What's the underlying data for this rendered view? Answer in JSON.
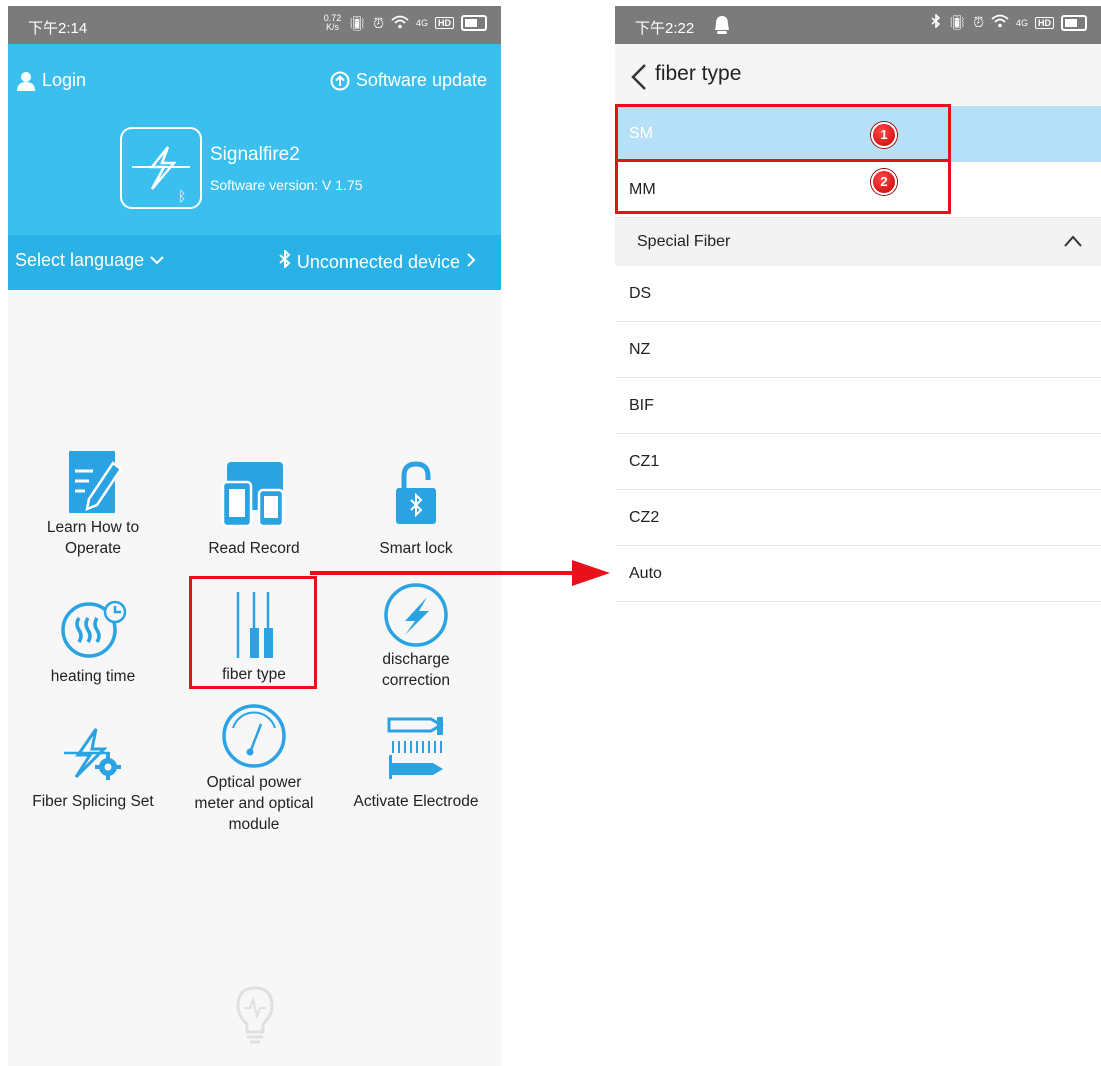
{
  "left_phone": {
    "status": {
      "time": "下午2:14",
      "speed_top": "0.72",
      "speed_bottom": "K/s",
      "signal": "4G",
      "hd": "HD"
    },
    "header": {
      "login_label": "Login",
      "software_update_label": "Software update",
      "app_name": "Signalfire2",
      "app_version": "Software version: V 1.75"
    },
    "subbar": {
      "language_label": "Select language",
      "device_label": "Unconnected device"
    },
    "grid": {
      "learn_line1": "Learn How to",
      "learn_line2": "Operate",
      "read_record": "Read Record",
      "smart_lock": "Smart lock",
      "heating_time": "heating time",
      "fiber_type": "fiber type",
      "discharge_line1": "discharge",
      "discharge_line2": "correction",
      "fiber_splicing_set": "Fiber Splicing Set",
      "optical_line1": "Optical power",
      "optical_line2": "meter and optical",
      "optical_line3": "module",
      "activate_electrode": "Activate Electrode"
    },
    "icons": [
      "user-icon",
      "upload-circle-icon",
      "app-logo-icon",
      "chevron-down-icon",
      "bluetooth-icon",
      "chevron-right-icon",
      "edit-note-icon",
      "tablet-phone-icon",
      "bluetooth-lock-icon",
      "heat-timer-icon",
      "fiber-icon",
      "lightning-circle-icon",
      "lightning-gear-icon",
      "gauge-icon",
      "electrode-icon",
      "lightbulb-icon"
    ]
  },
  "right_phone": {
    "status": {
      "time": "下午2:22",
      "signal": "4G",
      "hd": "HD"
    },
    "title": "fiber type",
    "options": [
      "SM",
      "MM"
    ],
    "selected_option": "SM",
    "group_label": "Special Fiber",
    "special_options": [
      "DS",
      "NZ",
      "BIF",
      "CZ1",
      "CZ2",
      "Auto"
    ],
    "badges": [
      "1",
      "2"
    ]
  },
  "colors": {
    "header_blue": "#3bbfee",
    "subbar_blue": "#2ab2e6",
    "icon_blue": "#2ba3e3",
    "selected_row": "#b6e0f7",
    "annotation_red": "#e8101a"
  }
}
